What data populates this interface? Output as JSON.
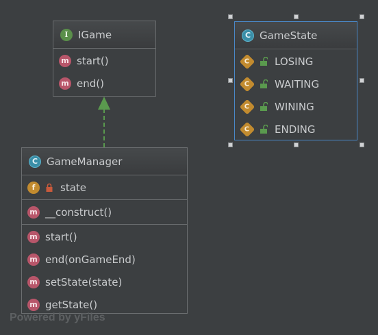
{
  "nodes": {
    "igame": {
      "name": "IGame",
      "kind": "interface",
      "methods": [
        "start()",
        "end()"
      ]
    },
    "gamestate": {
      "name": "GameState",
      "kind": "class",
      "constants": [
        "LOSING",
        "WAITING",
        "WINING",
        "ENDING"
      ]
    },
    "gamemanager": {
      "name": "GameManager",
      "kind": "class",
      "fields": [
        "state"
      ],
      "constructors": [
        "__construct()"
      ],
      "methods": [
        "start()",
        "end(onGameEnd)",
        "setState(state)",
        "getState()"
      ]
    }
  },
  "edges": [
    {
      "from": "GameManager",
      "to": "IGame",
      "type": "implements"
    }
  ],
  "badges": {
    "interface": "I",
    "class": "C",
    "method": "m",
    "field": "f",
    "constant": "C"
  },
  "colors": {
    "background": "#3c3f41",
    "border": "#6b6e70",
    "selection": "#4a88c7",
    "edge": "#5a9a4e",
    "method_badge": "#b8566a",
    "class_badge": "#3a8fa8",
    "interface_badge": "#5a8f4a",
    "field_badge": "#c28b2f"
  },
  "watermark": "Powered by yFiles"
}
